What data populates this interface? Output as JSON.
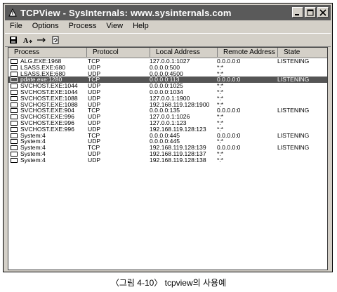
{
  "window": {
    "title": "TCPView - SysInternals: www.sysinternals.com",
    "icon": "tcpview-app-icon"
  },
  "menu": [
    "File",
    "Options",
    "Process",
    "View",
    "Help"
  ],
  "toolbar": [
    {
      "icon": "save-icon"
    },
    {
      "icon": "resolve-addresses-icon"
    },
    {
      "icon": "arrow-right-icon"
    },
    {
      "icon": "refresh-document-icon"
    }
  ],
  "columns": [
    "Process",
    "Protocol",
    "Local Address",
    "Remote Address",
    "State"
  ],
  "rows": [
    {
      "process": "ALG.EXE:1968",
      "protocol": "TCP",
      "local": "127.0.0.1:1027",
      "remote": "0.0.0.0:0",
      "state": "LISTENING",
      "selected": false
    },
    {
      "process": "LSASS.EXE:680",
      "protocol": "UDP",
      "local": "0.0.0.0:500",
      "remote": "*:*",
      "state": "",
      "selected": false
    },
    {
      "process": "LSASS.EXE:680",
      "protocol": "UDP",
      "local": "0.0.0.0:4500",
      "remote": "*:*",
      "state": "",
      "selected": false
    },
    {
      "process": "pdate.exe:1280",
      "protocol": "TCP",
      "local": "0.0.0.0:113",
      "remote": "0.0.0.0:0",
      "state": "LISTENING",
      "selected": true
    },
    {
      "process": "SVCHOST.EXE:1044",
      "protocol": "UDP",
      "local": "0.0.0.0:1025",
      "remote": "*:*",
      "state": "",
      "selected": false
    },
    {
      "process": "SVCHOST.EXE:1044",
      "protocol": "UDP",
      "local": "0.0.0.0:1034",
      "remote": "*:*",
      "state": "",
      "selected": false
    },
    {
      "process": "SVCHOST.EXE:1088",
      "protocol": "UDP",
      "local": "127.0.0.1:1900",
      "remote": "*:*",
      "state": "",
      "selected": false
    },
    {
      "process": "SVCHOST.EXE:1088",
      "protocol": "UDP",
      "local": "192.168.119.128:1900",
      "remote": "*:*",
      "state": "",
      "selected": false
    },
    {
      "process": "SVCHOST.EXE:904",
      "protocol": "TCP",
      "local": "0.0.0.0:135",
      "remote": "0.0.0.0:0",
      "state": "LISTENING",
      "selected": false
    },
    {
      "process": "SVCHOST.EXE:996",
      "protocol": "UDP",
      "local": "127.0.0.1:1026",
      "remote": "*:*",
      "state": "",
      "selected": false
    },
    {
      "process": "SVCHOST.EXE:996",
      "protocol": "UDP",
      "local": "127.0.0.1:123",
      "remote": "*:*",
      "state": "",
      "selected": false
    },
    {
      "process": "SVCHOST.EXE:996",
      "protocol": "UDP",
      "local": "192.168.119.128:123",
      "remote": "*:*",
      "state": "",
      "selected": false
    },
    {
      "process": "System:4",
      "protocol": "TCP",
      "local": "0.0.0.0:445",
      "remote": "0.0.0.0:0",
      "state": "LISTENING",
      "selected": false
    },
    {
      "process": "System:4",
      "protocol": "UDP",
      "local": "0.0.0.0:445",
      "remote": "*:*",
      "state": "",
      "selected": false
    },
    {
      "process": "System:4",
      "protocol": "TCP",
      "local": "192.168.119.128:139",
      "remote": "0.0.0.0:0",
      "state": "LISTENING",
      "selected": false
    },
    {
      "process": "System:4",
      "protocol": "UDP",
      "local": "192.168.119.128:137",
      "remote": "*:*",
      "state": "",
      "selected": false
    },
    {
      "process": "System:4",
      "protocol": "UDP",
      "local": "192.168.119.128:138",
      "remote": "*:*",
      "state": "",
      "selected": false
    }
  ],
  "caption": "〈그림 4-10〉 tcpview의 사용예",
  "colors": {
    "titlebar": "#5a5a5a",
    "selected_row": "#555555",
    "window_face": "#d4d0c8"
  }
}
